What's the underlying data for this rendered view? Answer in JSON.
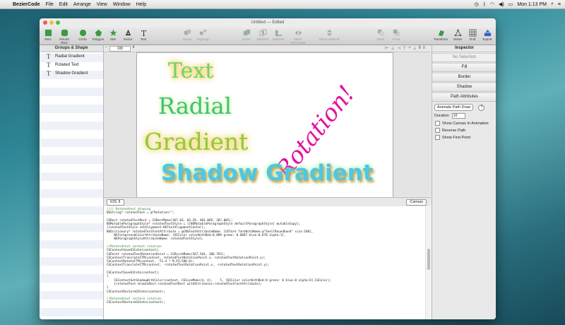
{
  "menubar": {
    "app_name": "BezierCode",
    "menus": [
      "File",
      "Edit",
      "Arrange",
      "View",
      "Window",
      "Help"
    ],
    "clock": "Mon 1:13 PM"
  },
  "window": {
    "title": "Untitled — Edited"
  },
  "toolbar": {
    "left_tools": [
      {
        "label": "Rect",
        "icon": "rect-icon"
      },
      {
        "label": "Round Rect",
        "icon": "round-rect-icon"
      },
      {
        "label": "Circle",
        "icon": "circle-icon"
      },
      {
        "label": "Polygon",
        "icon": "polygon-icon"
      },
      {
        "label": "Star",
        "icon": "star-icon"
      },
      {
        "label": "Vector",
        "icon": "vector-pen-icon"
      },
      {
        "label": "Text",
        "icon": "text-icon"
      }
    ],
    "middle_tools": [
      {
        "label": "Group",
        "icon": "group-icon"
      },
      {
        "label": "Ungroup",
        "icon": "ungroup-icon"
      },
      {
        "label": "Union",
        "icon": "union-icon"
      },
      {
        "label": "Intersect",
        "icon": "intersect-icon"
      },
      {
        "label": "Subtract",
        "icon": "subtract-icon"
      },
      {
        "label": "Mirror Horizontal",
        "icon": "mirror-horizontal-icon"
      },
      {
        "label": "Mirror Vertical",
        "icon": "mirror-vertical-icon"
      }
    ],
    "arrange_tools": [
      {
        "label": "Back",
        "icon": "send-back-icon"
      },
      {
        "label": "Front",
        "icon": "bring-front-icon"
      }
    ],
    "right_tools": [
      {
        "label": "Transform",
        "icon": "transform-icon"
      },
      {
        "label": "Vertex",
        "icon": "vertex-icon"
      },
      {
        "label": "Grid",
        "icon": "grid-icon"
      },
      {
        "label": "Export",
        "icon": "export-icon"
      }
    ]
  },
  "sidebar": {
    "header": "Groups & Shape",
    "items": [
      {
        "label": "Radial Gradient"
      },
      {
        "label": "Rotated Text"
      },
      {
        "label": "Shadow Gradient"
      }
    ]
  },
  "canvas": {
    "zoom": "100",
    "art_text": {
      "text": "Text",
      "radial": "Radial",
      "gradient": "Gradient",
      "rotation": "Rotation!",
      "shadow_gradient": "Shadow Gradient"
    }
  },
  "lowerbar": {
    "platform": "iOS",
    "canvas_button": "Canvas"
  },
  "code_lines": [
    "//// Rotatedtext drawing",
    "NSString* rotatedText = @\"Rotation!\";",
    "",
    "CGRect rotatedTextRect = CGRectMake(367.03, 83.29, 401.069, 207.005);",
    "NSMutableParagraphStyle* rotatedTextStyle = [[NSMutableParagraphStyle defaultParagraphStyle] mutableCopy];",
    "[rotatedTextStyle setAlignment:NSTextAlignmentCenter];",
    "NSDictionary* rotatedTextFontAttribute = @{NSFontAttributeName: [UIFont fontWithName:@\"SnellRoundhand\" size:100],",
    "    NSForegroundColorAttributeName: [UIColor colorWithRed:0.889 green: 0.0687 blue:0.678 alpha:1],",
    "    NSParagraphStyleAttributeName: rotatedTextStyle};",
    "",
    "//Rotatedtext context rotation",
    "CGContextSaveGState(context);",
    "CGPoint rotatedTextRotationPoint = CGPointMake(567.564, 186.793);",
    "CGContextTranslateCTM(context, rotatedTextRotationPoint.x, rotatedTextRotationPoint.y);",
    "CGContextRotateCTM(context, -51.4 * M_PI/180.0);",
    "CGContextTranslateCTM(context, -rotatedTextRotationPoint.x, -rotatedTextRotationPoint.y);",
    "",
    "CGContextSaveGState(context);",
    "{",
    "    CGContextSetShadowWithColor(context, CGSizeMake(4, 4),    5, [UIColor colorWithRed:0 green: 0 blue:0 alpha:0].CGColor);",
    "    [rotatedText drawInRect:rotatedTextRect withAttributes:rotatedTextFontAttribute];",
    "}",
    "CGContextRestoreGState(context);",
    "",
    "//Rotatedtext restore rotation",
    "CGContextRestoreGState(context);"
  ],
  "inspector": {
    "title": "Inspector",
    "no_selection": "No Selection",
    "sections": [
      "Fill",
      "Border",
      "Shadow",
      "Path Attributes"
    ],
    "animate_button": "Animate Path Draw",
    "help": "?",
    "duration_label": "Duration",
    "duration_value": "10",
    "options": [
      "Show Canvas In Animation",
      "Reverse Path",
      "Show First Point"
    ]
  },
  "colors": {
    "rotation_text": "#e3119f",
    "toolbar_icon_green": "#3c9a46",
    "export_blue": "#2f63c8"
  }
}
